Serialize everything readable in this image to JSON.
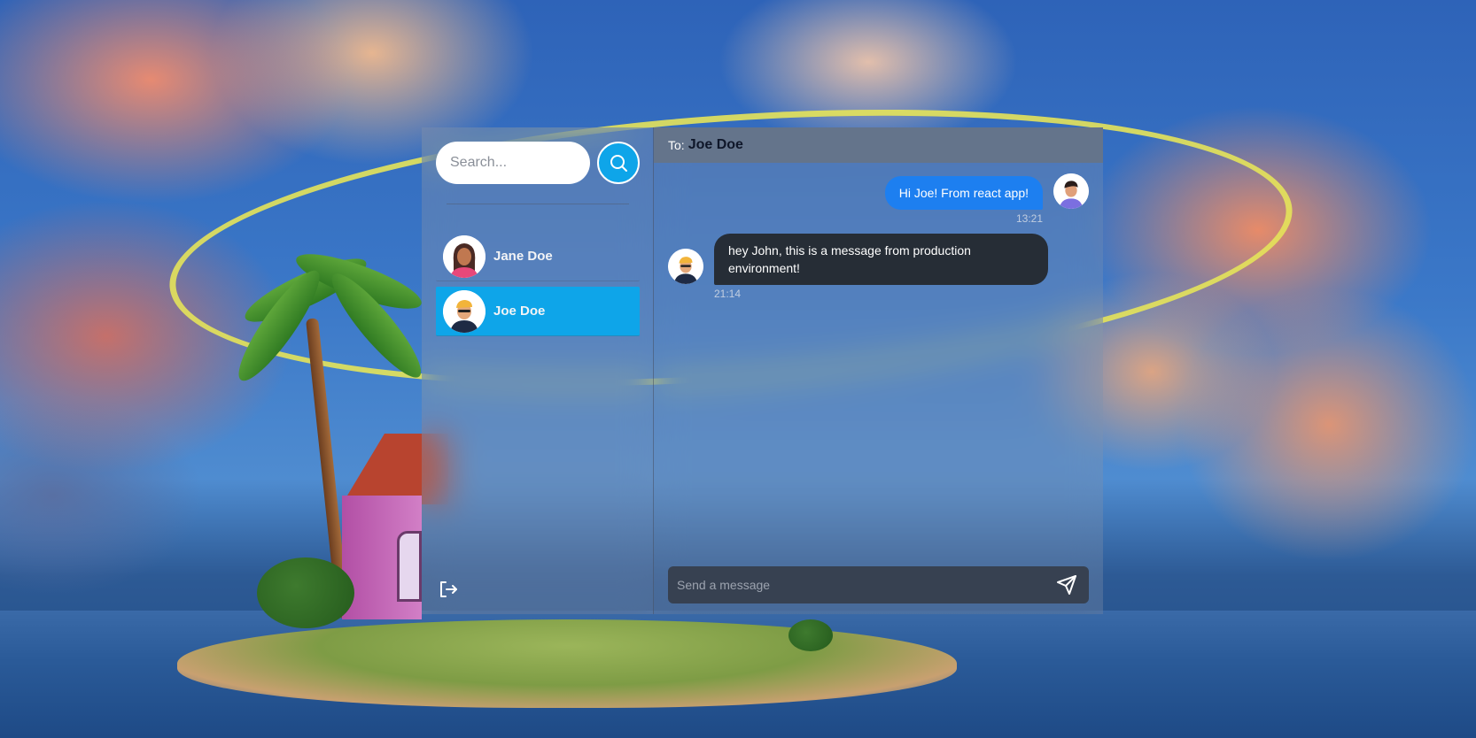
{
  "search": {
    "placeholder": "Search...",
    "icon": "search-icon"
  },
  "conversations": [
    {
      "name": "Jane Doe",
      "active": false,
      "avatar": "female-avatar"
    },
    {
      "name": "Joe Doe",
      "active": true,
      "avatar": "male-avatar-cap"
    }
  ],
  "sidebar": {
    "logout_icon": "logout-icon"
  },
  "header": {
    "to_label": "To:",
    "to_name": "Joe Doe"
  },
  "messages": [
    {
      "direction": "outgoing",
      "text": "Hi Joe! From react app!",
      "time": "13:21",
      "avatar": "male-avatar"
    },
    {
      "direction": "incoming",
      "text": "hey John, this is a message from production environment!",
      "time": "21:14",
      "avatar": "male-avatar-cap"
    }
  ],
  "composer": {
    "placeholder": "Send a message",
    "send_icon": "send-icon"
  },
  "colors": {
    "accent": "#0ea5e9",
    "outgoing_bubble": "#1d7ff0",
    "incoming_bubble": "#262d36",
    "header_bg": "#64748b",
    "composer_bg": "#374151"
  }
}
